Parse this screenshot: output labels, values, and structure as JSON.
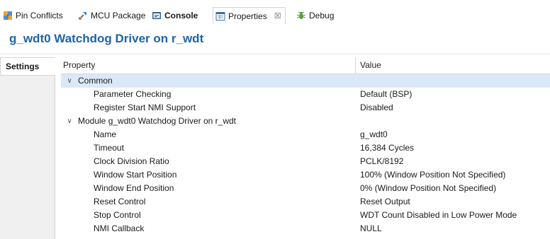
{
  "tabs": [
    {
      "label": "Pin Conflicts",
      "icon": "pin-conflicts-icon"
    },
    {
      "label": "MCU Package",
      "icon": "mcu-package-icon"
    },
    {
      "label": "Console",
      "icon": "console-icon"
    },
    {
      "label": "Properties",
      "icon": "properties-icon",
      "close": "☒"
    },
    {
      "label": "Debug",
      "icon": "debug-icon"
    }
  ],
  "title": "g_wdt0 Watchdog Driver on r_wdt",
  "left_tab": "Settings",
  "table": {
    "headers": {
      "property": "Property",
      "value": "Value"
    },
    "groups": [
      {
        "label": "Common",
        "rows": [
          {
            "property": "Parameter Checking",
            "value": "Default (BSP)"
          },
          {
            "property": "Register Start NMI Support",
            "value": "Disabled"
          }
        ]
      },
      {
        "label": "Module g_wdt0 Watchdog Driver on r_wdt",
        "rows": [
          {
            "property": "Name",
            "value": "g_wdt0"
          },
          {
            "property": "Timeout",
            "value": "16,384 Cycles"
          },
          {
            "property": "Clock Division Ratio",
            "value": "PCLK/8192"
          },
          {
            "property": "Window Start Position",
            "value": "100% (Window Position Not Specified)"
          },
          {
            "property": "Window End Position",
            "value": "0% (Window Position Not Specified)"
          },
          {
            "property": "Reset Control",
            "value": "Reset Output"
          },
          {
            "property": "Stop Control",
            "value": "WDT Count Disabled in Low Power Mode"
          },
          {
            "property": "NMI Callback",
            "value": "NULL"
          }
        ]
      }
    ]
  },
  "colors": {
    "title": "#1c63ad",
    "selection": "#dbe8f7"
  }
}
